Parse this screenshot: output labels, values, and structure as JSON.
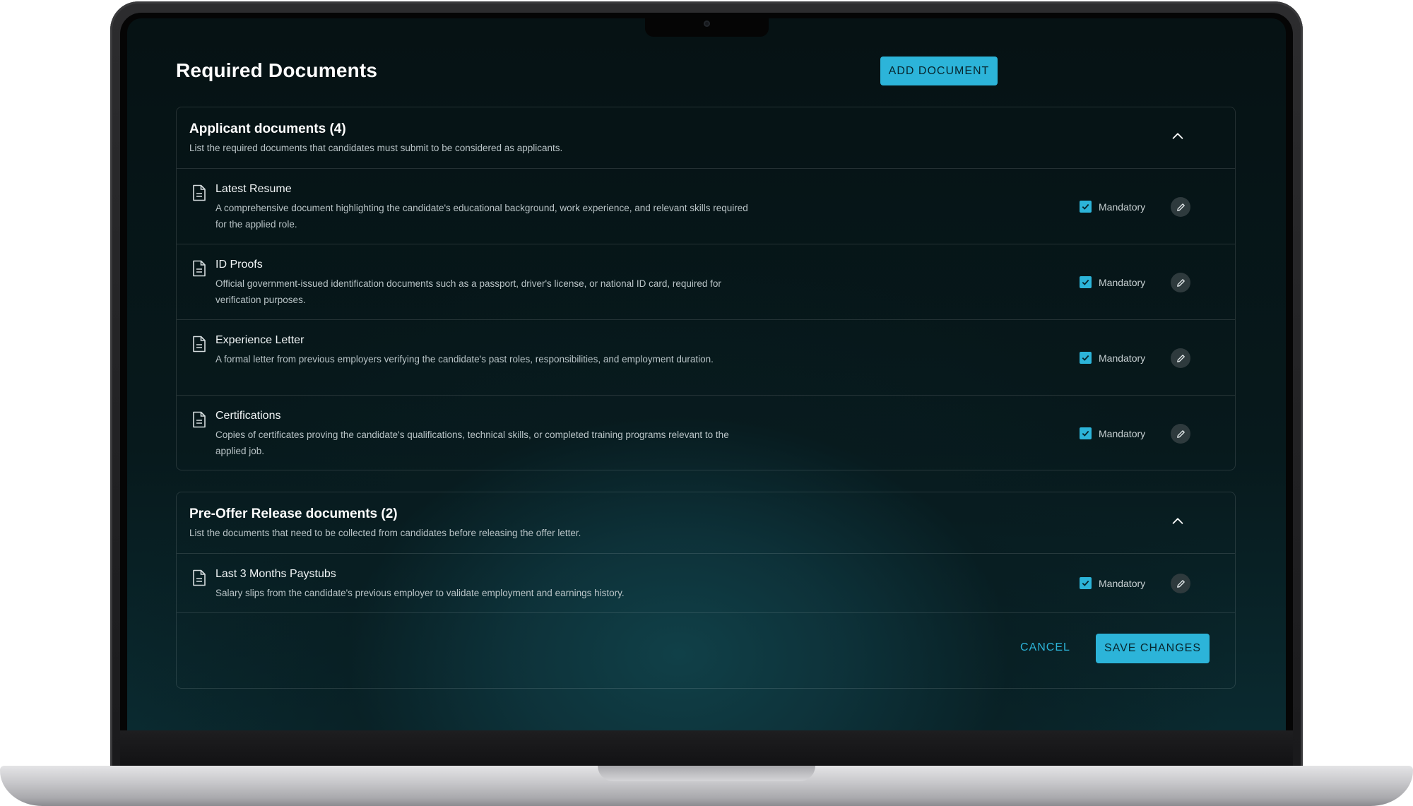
{
  "page": {
    "title": "Required Documents",
    "add_document_label": "ADD DOCUMENT"
  },
  "sections": [
    {
      "title": "Applicant documents (4)",
      "subtitle": "List the required documents that candidates must submit to be considered as applicants.",
      "items": [
        {
          "title": "Latest Resume",
          "description": "A comprehensive document highlighting the candidate's educational background, work experience, and relevant skills required for the applied role.",
          "mandatory_label": "Mandatory",
          "mandatory": true
        },
        {
          "title": "ID Proofs",
          "description": "Official government-issued identification documents such as a passport, driver's license, or national ID card, required for verification purposes.",
          "mandatory_label": "Mandatory",
          "mandatory": true
        },
        {
          "title": "Experience Letter",
          "description": "A formal letter from previous employers verifying the candidate's past roles, responsibilities, and employment duration.",
          "mandatory_label": "Mandatory",
          "mandatory": true
        },
        {
          "title": "Certifications",
          "description": "Copies of certificates proving the candidate's qualifications, technical skills, or completed training programs relevant to the applied job.",
          "mandatory_label": "Mandatory",
          "mandatory": true
        }
      ]
    },
    {
      "title": "Pre-Offer Release documents (2)",
      "subtitle": "List the documents that need to be collected from candidates before releasing the offer letter.",
      "items": [
        {
          "title": "Last 3 Months Paystubs",
          "description": "Salary slips from the candidate's previous employer to validate employment and earnings history.",
          "mandatory_label": "Mandatory",
          "mandatory": true
        }
      ]
    }
  ],
  "footer": {
    "cancel_label": "CANCEL",
    "save_label": "SAVE CHANGES"
  },
  "colors": {
    "accent": "#2cb4d9",
    "background": "#061214",
    "text_primary": "#ffffff",
    "text_secondary": "#b9c4c7"
  },
  "icons": {
    "document": "document-icon",
    "chevron": "chevron-up-icon",
    "edit": "pencil-icon",
    "check": "check-icon"
  }
}
